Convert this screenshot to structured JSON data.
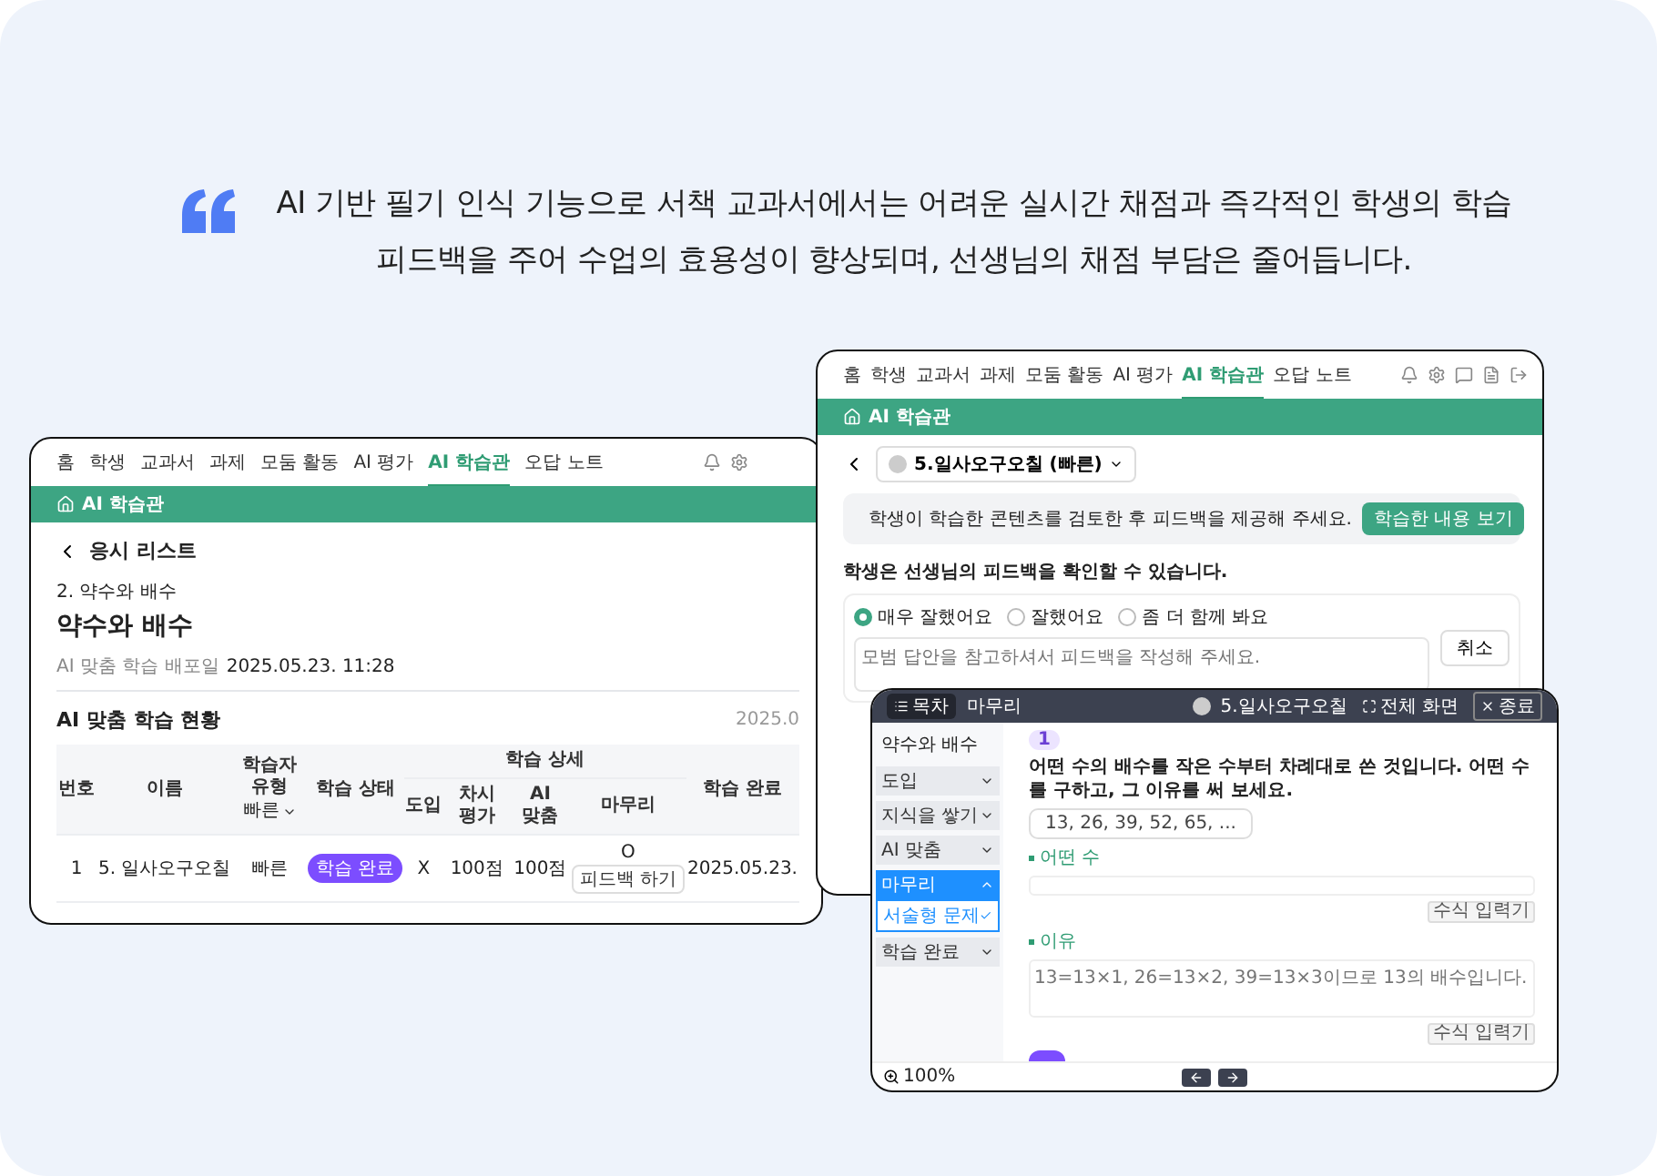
{
  "quote": {
    "lines": [
      "AI 기반 필기 인식 기능으로 서책 교과서에서는 어려운 실시간 채점과 즉각적인 학생의 학습",
      "피드백을 주어 수업의 효용성이 향상되며, 선생님의 채점 부담은 줄어듭니다."
    ]
  },
  "list_window": {
    "nav": [
      {
        "label": "홈",
        "selected": false
      },
      {
        "label": "학생",
        "selected": false
      },
      {
        "label": "교과서",
        "selected": false
      },
      {
        "label": "과제",
        "selected": false
      },
      {
        "label": "모둠 활동",
        "selected": false
      },
      {
        "label": "AI 평가",
        "selected": false
      },
      {
        "label": "AI 학습관",
        "selected": true
      },
      {
        "label": "오답 노트",
        "selected": false
      }
    ],
    "bar_title": "AI 학습관",
    "back_title": "응시 리스트",
    "unit": "2. 약수와 배수",
    "title": "약수와 배수",
    "deploy_label": "AI 맞춤 학습 배포일",
    "deploy_date": "2025.05.23. 11:28",
    "section_title": "AI 맞춤 학습 현황",
    "section_date": "2025.0",
    "table": {
      "columns": [
        "번호",
        "이름",
        "학습자 유형",
        "학습 상태"
      ],
      "type_filter": "빠른",
      "detail_group": "학습 상세",
      "detail_columns": [
        "도입",
        "차시 평가",
        "AI 맞춤",
        "마무리"
      ],
      "last_column": "학습 완료",
      "rows": [
        {
          "number": "1",
          "name": "5. 일사오구오칠",
          "learner_type": "빠른",
          "status": "학습 완료",
          "intro": "X",
          "lesson_eval": "100점",
          "ai_custom": "100점",
          "wrap_up": "O",
          "feedback_button": "피드백 하기",
          "completed": "2025.05.23."
        }
      ]
    }
  },
  "feedback_window": {
    "nav": [
      {
        "label": "홈",
        "selected": false
      },
      {
        "label": "학생",
        "selected": false
      },
      {
        "label": "교과서",
        "selected": false
      },
      {
        "label": "과제",
        "selected": false
      },
      {
        "label": "모둠 활동",
        "selected": false
      },
      {
        "label": "AI 평가",
        "selected": false
      },
      {
        "label": "AI 학습관",
        "selected": true
      },
      {
        "label": "오답 노트",
        "selected": false
      }
    ],
    "bar_title": "AI 학습관",
    "student_select": "5.일사오구오칠 (빠른)",
    "banner_text": "학생이 학습한 콘텐츠를 검토한 후 피드백을 제공해 주세요.",
    "banner_button": "학습한 내용 보기",
    "heading": "학생은 선생님의 피드백을 확인할 수 있습니다.",
    "ratings": [
      {
        "label": "매우 잘했어요",
        "selected": true
      },
      {
        "label": "잘했어요",
        "selected": false
      },
      {
        "label": "좀 더 함께 봐요",
        "selected": false
      }
    ],
    "feedback_placeholder": "모범 답안을 참고하셔서 피드백을 작성해 주세요.",
    "cancel_button": "취소"
  },
  "viewer_window": {
    "toc_button": "목차",
    "section": "마무리",
    "student": "5.일사오구오칠",
    "fullscreen": "전체 화면",
    "close": "종료",
    "sidebar_title": "약수와 배수",
    "sidebar": [
      {
        "label": "도입",
        "selected": false,
        "expanded": false
      },
      {
        "label": "지식을 쌓기",
        "selected": false,
        "expanded": false
      },
      {
        "label": "AI 맞춤",
        "selected": false,
        "expanded": false
      },
      {
        "label": "마무리",
        "selected": true,
        "expanded": true,
        "children": [
          {
            "label": "서술형 문제",
            "checked": true
          }
        ]
      },
      {
        "label": "학습 완료",
        "selected": false,
        "expanded": false
      }
    ],
    "question_number": "1",
    "question": "어떤 수의 배수를 작은 수부터 차례대로 쓴 것입니다. 어떤 수를 구하고, 그 이유를 써 보세요.",
    "sequence": "13, 26, 39, 52, 65, ...",
    "answers": [
      {
        "kind": "input",
        "label": "어떤 수",
        "button": "수식 입력기"
      },
      {
        "kind": "textarea",
        "label": "이유",
        "placeholder": "13=13×1, 26=13×2, 39=13×3이므로 13의 배수입니다.",
        "button": "수식 입력기"
      }
    ],
    "zoom": "100%"
  }
}
